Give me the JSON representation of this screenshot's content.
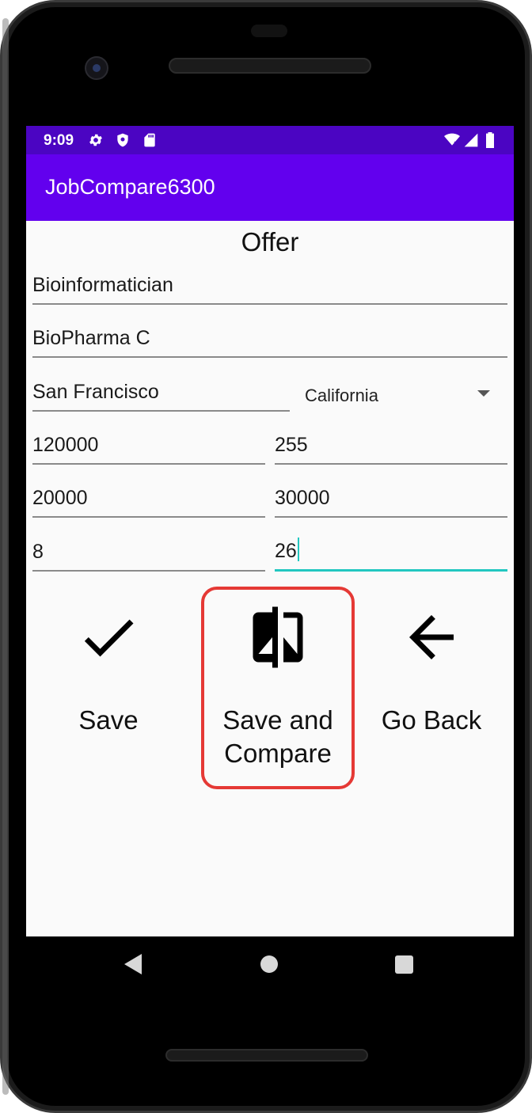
{
  "status_bar": {
    "time": "9:09",
    "left_icons": [
      "gear-icon",
      "shield-icon",
      "sd-card-icon"
    ],
    "right_icons": [
      "wifi-icon",
      "signal-icon",
      "battery-icon"
    ]
  },
  "app_bar": {
    "title": "JobCompare6300"
  },
  "form": {
    "heading": "Offer",
    "title_value": "Bioinformatician",
    "company_value": "BioPharma C",
    "city_value": "San Francisco",
    "state_value": "California",
    "salary_value": "120000",
    "cost_of_living_value": "255",
    "bonus_value": "20000",
    "stock_value": "30000",
    "relocation_value": "8",
    "training_value": "26"
  },
  "actions": {
    "save_label": "Save",
    "save_compare_label_line1": "Save and",
    "save_compare_label_line2": "Compare",
    "go_back_label": "Go Back"
  },
  "colors": {
    "status_bar": "#4b05c2",
    "app_bar": "#6200ee",
    "focus_underline": "#22c7c0",
    "highlight_border": "#e53935"
  },
  "nav_bar": {
    "icons": [
      "back-icon",
      "home-icon",
      "recents-icon"
    ]
  }
}
